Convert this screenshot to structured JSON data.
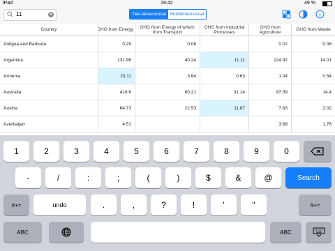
{
  "status": {
    "device": "iPad",
    "time": "19:42",
    "battery": "49 %"
  },
  "search": {
    "value": "11"
  },
  "view_toggle": {
    "two_dimensional": "Two-dimensional",
    "multidimensional": "Multidimensional"
  },
  "table": {
    "columns": [
      "Country",
      "GHG from Energy",
      "GHG from Energy of which: from Transport",
      "GHG from Industrial Processes",
      "GHG from Agriculture",
      "GHG from Waste"
    ],
    "rows": [
      {
        "country": "Antigua and Barbuda",
        "values": [
          "0.29",
          "0.08",
          "",
          "0.02",
          "0.08"
        ]
      },
      {
        "country": "Argentina",
        "values": [
          "131.96",
          "40.24",
          "11.11",
          "124.92",
          "14.01"
        ]
      },
      {
        "country": "Armenia",
        "values": [
          "23.11",
          "3.64",
          "0.63",
          "1.04",
          "0.54"
        ]
      },
      {
        "country": "Australia",
        "values": [
          "416.6",
          "80.21",
          "31.14",
          "87.39",
          "14.4"
        ]
      },
      {
        "country": "Austria",
        "values": [
          "64.73",
          "22.53",
          "11.87",
          "7.63",
          "2.02"
        ]
      },
      {
        "country": "Azerbaijan",
        "values": [
          "4.51",
          "",
          "",
          "3.68",
          "1.76"
        ]
      }
    ]
  },
  "keyboard": {
    "row1": [
      "1",
      "2",
      "3",
      "4",
      "5",
      "6",
      "7",
      "8",
      "9",
      "0"
    ],
    "row2": [
      "-",
      "/",
      ":",
      ";",
      "(",
      ")",
      "$",
      "&",
      "@"
    ],
    "search_label": "Search",
    "symbols_label": "#+=",
    "undo_label": "undo",
    "row3": [
      ".",
      ",",
      "?",
      "!",
      "'",
      "\""
    ],
    "abc_label": "ABC"
  }
}
